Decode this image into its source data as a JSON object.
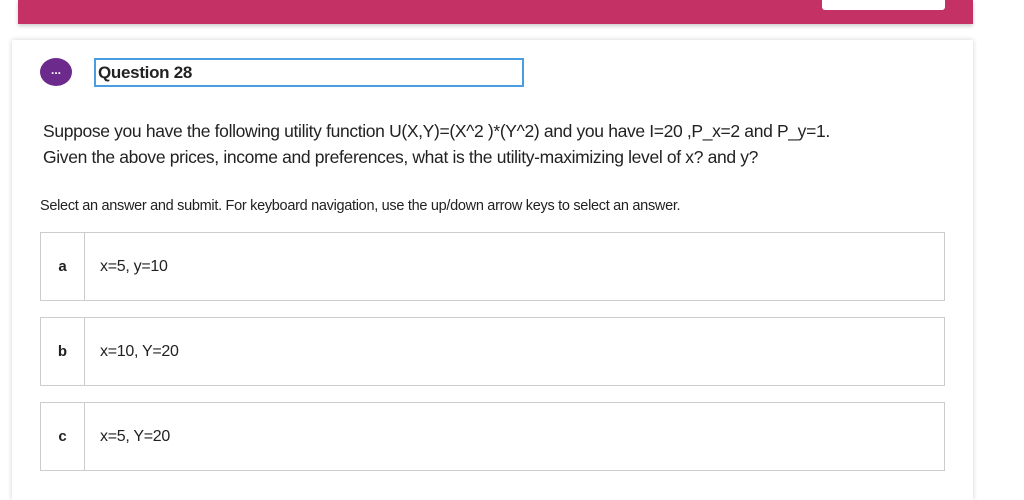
{
  "question": {
    "title": "Question 28",
    "icon": "chat-bubble-icon",
    "icon_glyph": "...",
    "prompt_line1": "Suppose you have the following utility function U(X,Y)=(X^2 )*(Y^2) and you have I=20 ,P_x=2 and P_y=1.",
    "prompt_line2": "Given the above prices, income and preferences, what is the utility-maximizing level of x? and y?",
    "instructions": "Select an answer and submit. For keyboard navigation, use the up/down arrow keys to select an answer."
  },
  "options": [
    {
      "letter": "a",
      "text": "x=5, y=10"
    },
    {
      "letter": "b",
      "text": "x=10, Y=20"
    },
    {
      "letter": "c",
      "text": "x=5, Y=20"
    }
  ],
  "colors": {
    "header": "#c43165",
    "icon": "#6b2a8c",
    "focus": "#4a9de0"
  }
}
